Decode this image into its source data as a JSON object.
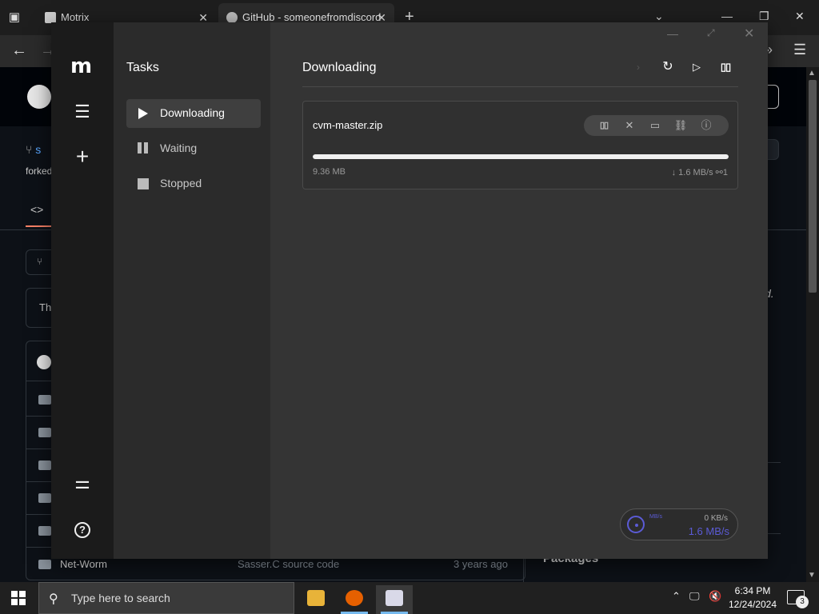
{
  "browser": {
    "tabs": [
      {
        "label": "Motrix"
      },
      {
        "label": "GitHub - someonefromdiscord"
      }
    ],
    "new_tab": "+"
  },
  "github": {
    "repo_link_fragment": "s",
    "forked_fragment": "forked",
    "tree_row_fragment": "Th",
    "italic_fragment": "d.",
    "last_row": {
      "name": "Net-Worm",
      "message": "Sasser.C source code",
      "time": "3 years ago"
    },
    "packages_heading": "Packages"
  },
  "motrix": {
    "logo": "m",
    "sidebar_title": "Tasks",
    "nav": [
      {
        "label": "Downloading",
        "icon": "play-icon",
        "active": true
      },
      {
        "label": "Waiting",
        "icon": "pause-icon",
        "active": false
      },
      {
        "label": "Stopped",
        "icon": "stop-icon",
        "active": false
      }
    ],
    "main_title": "Downloading",
    "task": {
      "name": "cvm-master.zip",
      "size": "9.36 MB",
      "speed": "↓ 1.6 MB/s",
      "connections": "1",
      "progress": 1.0
    },
    "speedometer": {
      "unit": "MB/s",
      "upload": "0 KB/s",
      "download": "1.6 MB/s"
    }
  },
  "taskbar": {
    "search_placeholder": "Type here to search",
    "time": "6:34 PM",
    "date": "12/24/2024",
    "notification_count": "3"
  },
  "colors": {
    "accent": "#5b5bd6",
    "motrix_bg": "#343434",
    "motrix_rail": "#1b1b1b",
    "github_bg": "#0d1117"
  }
}
